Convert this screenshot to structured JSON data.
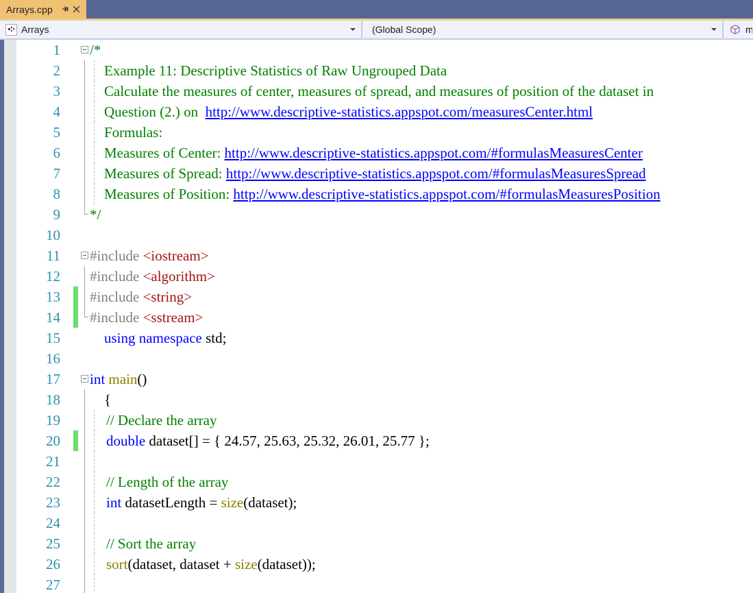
{
  "window": {
    "tab": {
      "title": "Arrays.cpp",
      "pin_icon": "pin-icon",
      "close_icon": "close-icon"
    }
  },
  "navbar": {
    "project": {
      "icon": "project-icon",
      "label": "Arrays"
    },
    "scope": {
      "label": "(Global Scope)"
    },
    "member": {
      "icon": "method-cube-icon",
      "label": "ma"
    }
  },
  "colors": {
    "tab_active_bg": "#f0c173",
    "titlebar_bg": "#586694",
    "navbar_bg": "#eff1fb",
    "edge_strip": "#5c6a97",
    "selection_margin": "#e5e6e9",
    "line_number": "#2b91af",
    "change_bar_saved": "#6ddb6d",
    "comment": "#008000",
    "keyword": "#0000ff",
    "preprocessor": "#808080",
    "header_name": "#a31515",
    "function_name": "#8b8000",
    "link": "#0000ff"
  },
  "editor": {
    "language": "cpp",
    "first_visible_line": 1,
    "last_visible_line": 27,
    "lines": [
      {
        "num": 1,
        "indent": 0,
        "fold": "start",
        "changed": false,
        "tokens": [
          {
            "t": "/*",
            "c": "cmt"
          }
        ]
      },
      {
        "num": 2,
        "indent": 1,
        "fold": "body",
        "changed": false,
        "guide": true,
        "tokens": [
          {
            "t": "Example 11: Descriptive Statistics of Raw Ungrouped Data",
            "c": "cmt"
          }
        ]
      },
      {
        "num": 3,
        "indent": 1,
        "fold": "body",
        "changed": false,
        "guide": true,
        "tokens": [
          {
            "t": "Calculate the measures of center, measures of spread, and measures of position of the dataset in",
            "c": "cmt"
          }
        ]
      },
      {
        "num": 4,
        "indent": 1,
        "fold": "body",
        "changed": false,
        "guide": true,
        "tokens": [
          {
            "t": "Question (2.) on  ",
            "c": "cmt"
          },
          {
            "t": "http://www.descriptive-statistics.appspot.com/measuresCenter.html",
            "c": "lnk"
          }
        ]
      },
      {
        "num": 5,
        "indent": 1,
        "fold": "body",
        "changed": false,
        "guide": true,
        "tokens": [
          {
            "t": "Formulas:",
            "c": "cmt"
          }
        ]
      },
      {
        "num": 6,
        "indent": 1,
        "fold": "body",
        "changed": false,
        "guide": true,
        "tokens": [
          {
            "t": "Measures of Center: ",
            "c": "cmt"
          },
          {
            "t": "http://www.descriptive-statistics.appspot.com/#formulasMeasuresCenter",
            "c": "lnk"
          }
        ]
      },
      {
        "num": 7,
        "indent": 1,
        "fold": "body",
        "changed": false,
        "guide": true,
        "tokens": [
          {
            "t": "Measures of Spread: ",
            "c": "cmt"
          },
          {
            "t": "http://www.descriptive-statistics.appspot.com/#formulasMeasuresSpread",
            "c": "lnk"
          }
        ]
      },
      {
        "num": 8,
        "indent": 1,
        "fold": "body",
        "changed": false,
        "guide": true,
        "tokens": [
          {
            "t": "Measures of Position: ",
            "c": "cmt"
          },
          {
            "t": "http://www.descriptive-statistics.appspot.com/#formulasMeasuresPosition",
            "c": "lnk"
          }
        ]
      },
      {
        "num": 9,
        "indent": 0,
        "fold": "end",
        "changed": false,
        "tokens": [
          {
            "t": "*/",
            "c": "cmt"
          }
        ]
      },
      {
        "num": 10,
        "indent": 0,
        "fold": "none",
        "changed": false,
        "tokens": []
      },
      {
        "num": 11,
        "indent": 0,
        "fold": "start",
        "changed": false,
        "tokens": [
          {
            "t": "#include ",
            "c": "pp"
          },
          {
            "t": "<iostream>",
            "c": "hdr"
          }
        ]
      },
      {
        "num": 12,
        "indent": 0,
        "fold": "body",
        "changed": false,
        "tokens": [
          {
            "t": "#include ",
            "c": "pp"
          },
          {
            "t": "<algorithm>",
            "c": "hdr"
          }
        ]
      },
      {
        "num": 13,
        "indent": 0,
        "fold": "body",
        "changed": true,
        "tokens": [
          {
            "t": "#include ",
            "c": "pp"
          },
          {
            "t": "<string>",
            "c": "hdr"
          }
        ]
      },
      {
        "num": 14,
        "indent": 0,
        "fold": "end",
        "changed": true,
        "tokens": [
          {
            "t": "#include ",
            "c": "pp"
          },
          {
            "t": "<sstream>",
            "c": "hdr"
          }
        ]
      },
      {
        "num": 15,
        "indent": 1,
        "fold": "none",
        "changed": false,
        "tokens": [
          {
            "t": "using namespace ",
            "c": "kw"
          },
          {
            "t": "std;",
            "c": "id"
          }
        ]
      },
      {
        "num": 16,
        "indent": 0,
        "fold": "none",
        "changed": false,
        "tokens": []
      },
      {
        "num": 17,
        "indent": 0,
        "fold": "start",
        "changed": false,
        "tokens": [
          {
            "t": "int ",
            "c": "kw"
          },
          {
            "t": "main",
            "c": "fn"
          },
          {
            "t": "()",
            "c": "punct"
          }
        ]
      },
      {
        "num": 18,
        "indent": 1,
        "fold": "body",
        "changed": false,
        "tokens": [
          {
            "t": "{",
            "c": "punct"
          }
        ]
      },
      {
        "num": 19,
        "indent": 2,
        "fold": "body",
        "changed": false,
        "guide": true,
        "tokens": [
          {
            "t": "// Declare the array",
            "c": "cmt"
          }
        ]
      },
      {
        "num": 20,
        "indent": 2,
        "fold": "body",
        "changed": true,
        "guide": true,
        "tokens": [
          {
            "t": "double ",
            "c": "kw"
          },
          {
            "t": "dataset[] = { 24.57, 25.63, 25.32, 26.01, 25.77 };",
            "c": "id"
          }
        ]
      },
      {
        "num": 21,
        "indent": 0,
        "fold": "body",
        "changed": false,
        "guide": true,
        "tokens": []
      },
      {
        "num": 22,
        "indent": 2,
        "fold": "body",
        "changed": false,
        "guide": true,
        "tokens": [
          {
            "t": "// Length of the array",
            "c": "cmt"
          }
        ]
      },
      {
        "num": 23,
        "indent": 2,
        "fold": "body",
        "changed": false,
        "guide": true,
        "tokens": [
          {
            "t": "int ",
            "c": "kw"
          },
          {
            "t": "datasetLength = ",
            "c": "id"
          },
          {
            "t": "size",
            "c": "fn"
          },
          {
            "t": "(dataset);",
            "c": "id"
          }
        ]
      },
      {
        "num": 24,
        "indent": 0,
        "fold": "body",
        "changed": false,
        "guide": true,
        "tokens": []
      },
      {
        "num": 25,
        "indent": 2,
        "fold": "body",
        "changed": false,
        "guide": true,
        "tokens": [
          {
            "t": "// Sort the array",
            "c": "cmt"
          }
        ]
      },
      {
        "num": 26,
        "indent": 2,
        "fold": "body",
        "changed": false,
        "guide": true,
        "tokens": [
          {
            "t": "sort",
            "c": "fn"
          },
          {
            "t": "(dataset, dataset + ",
            "c": "id"
          },
          {
            "t": "size",
            "c": "fn"
          },
          {
            "t": "(dataset));",
            "c": "id"
          }
        ]
      },
      {
        "num": 27,
        "indent": 0,
        "fold": "body",
        "changed": false,
        "guide": true,
        "tokens": []
      }
    ]
  }
}
